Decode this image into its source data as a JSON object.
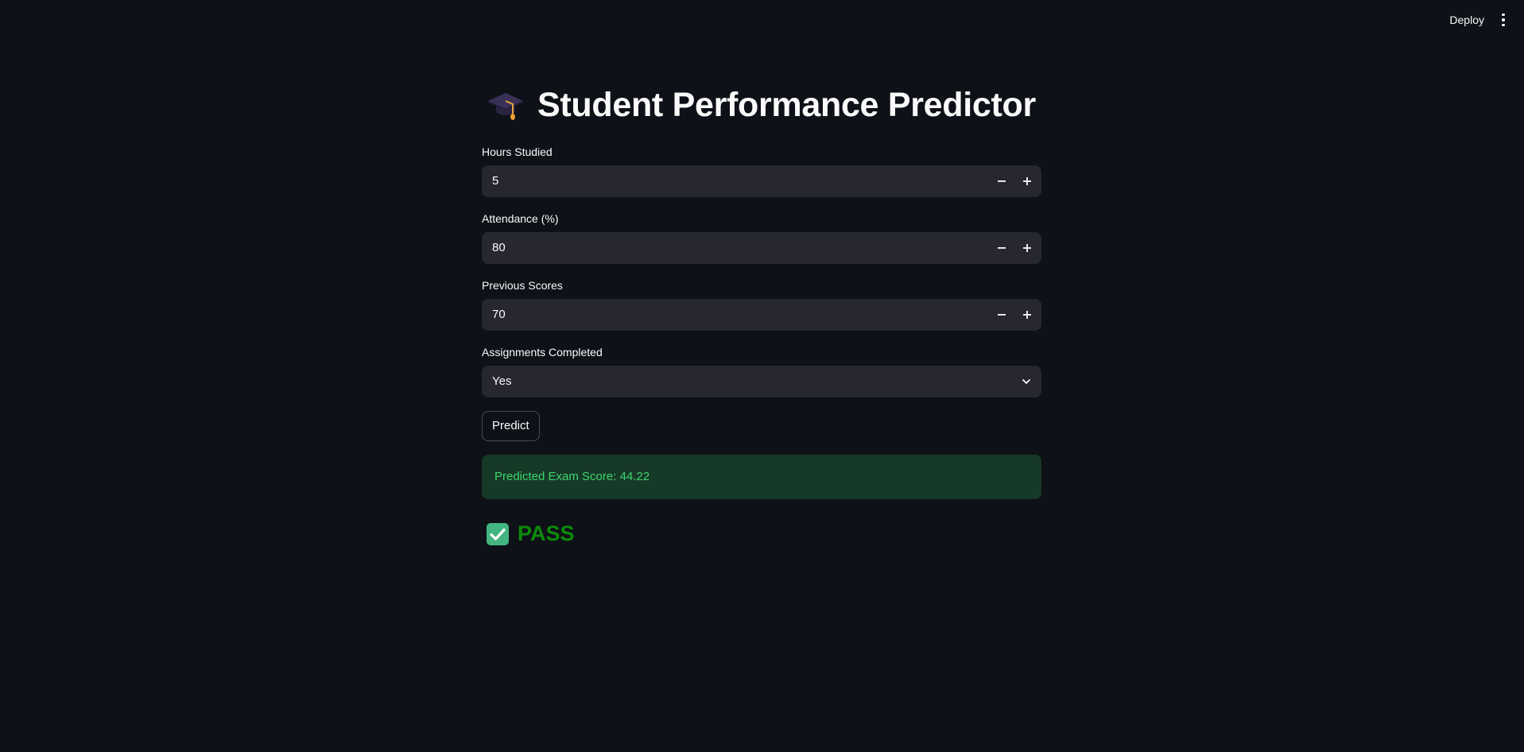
{
  "header": {
    "deploy_label": "Deploy",
    "menu_icon": "more-vertical-icon"
  },
  "app": {
    "title_icon": "graduation-cap-icon",
    "title": "Student Performance Predictor"
  },
  "form": {
    "hours": {
      "label": "Hours Studied",
      "value": "5"
    },
    "attendance": {
      "label": "Attendance (%)",
      "value": "80"
    },
    "previous": {
      "label": "Previous Scores",
      "value": "70"
    },
    "assignments": {
      "label": "Assignments Completed",
      "value": "Yes"
    },
    "predict_label": "Predict"
  },
  "result": {
    "prediction_text": "Predicted Exam Score: 44.22",
    "status_icon": "check-box-icon",
    "status_text": "PASS"
  },
  "colors": {
    "background": "#0e1117",
    "input_bg": "#262730",
    "success_bg": "#173928",
    "success_text": "#3dd56d",
    "pass_text": "#0b8a0b",
    "check_bg": "#43b581"
  }
}
